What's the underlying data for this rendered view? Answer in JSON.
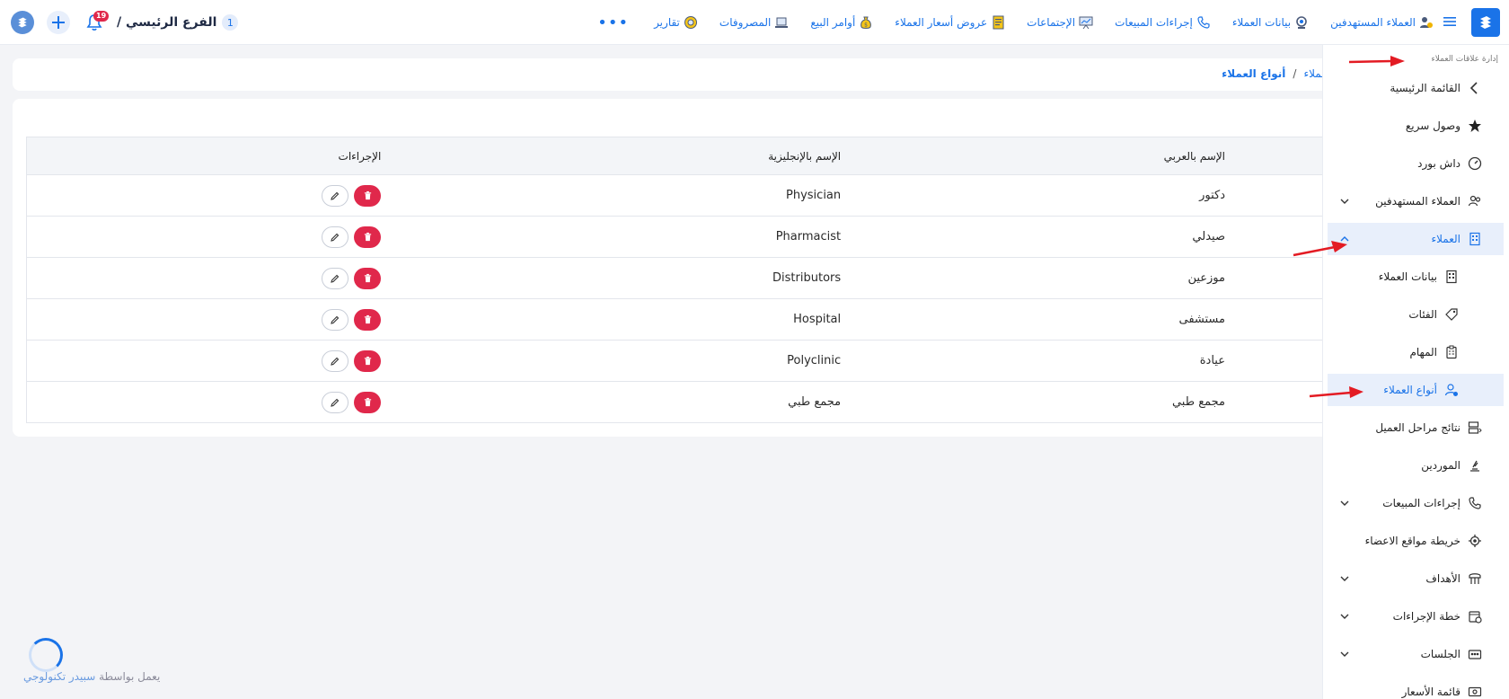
{
  "topbar": {
    "nav": [
      {
        "label": "العملاء المستهدفين",
        "icon": "targeted-clients-icon"
      },
      {
        "label": "بيانات العملاء",
        "icon": "webcam-icon"
      },
      {
        "label": "إجراءات المبيعات",
        "icon": "phone-icon"
      },
      {
        "label": "الإجتماعات",
        "icon": "presentation-icon"
      },
      {
        "label": "عروض أسعار العملاء",
        "icon": "quote-icon"
      },
      {
        "label": "أوامر البيع",
        "icon": "money-bag-icon"
      },
      {
        "label": "المصروفات",
        "icon": "laptop-icon"
      },
      {
        "label": "تقارير",
        "icon": "report-icon"
      }
    ],
    "more": "•••",
    "branch_label": "الفرع الرئيسي /",
    "branch_number": "1",
    "notifications_count": "19"
  },
  "breadcrumb": {
    "parent": "العملاء",
    "separator": "/",
    "current": "أنواع العملاء"
  },
  "table": {
    "headers": {
      "arabic_name": "الإسم بالعربي",
      "english_name": "الإسم بالإنجليزية",
      "actions": "الإجراءات"
    },
    "rows": [
      {
        "ar": "دكتور",
        "en": "Physician"
      },
      {
        "ar": "صيدلي",
        "en": "Pharmacist"
      },
      {
        "ar": "موزعين",
        "en": "Distributors"
      },
      {
        "ar": "مستشفى",
        "en": "Hospital"
      },
      {
        "ar": "عيادة",
        "en": "Polyclinic"
      },
      {
        "ar": "مجمع طبي",
        "en": "مجمع طبي"
      }
    ]
  },
  "sidebar": {
    "title": "إدارة علاقات العملاء",
    "items": [
      {
        "label": "القائمة الرئيسية",
        "icon": "chevron-left-icon"
      },
      {
        "label": "وصول سريع",
        "icon": "star-icon"
      },
      {
        "label": "داش بورد",
        "icon": "speedometer-icon"
      },
      {
        "label": "العملاء المستهدفين",
        "icon": "users-icon"
      },
      {
        "label": "العملاء",
        "icon": "building-icon"
      },
      {
        "label": "بيانات العملاء",
        "icon": "building-icon"
      },
      {
        "label": "الفئات",
        "icon": "tag-icon"
      },
      {
        "label": "المهام",
        "icon": "clipboard-icon"
      },
      {
        "label": "أنواع العملاء",
        "icon": "user-badge-icon"
      },
      {
        "label": "نتائج مراحل العميل",
        "icon": "stages-icon"
      },
      {
        "label": "الموردين",
        "icon": "supplier-icon"
      },
      {
        "label": "إجراءات المبيعات",
        "icon": "phone-call-icon"
      },
      {
        "label": "خريطة مواقع الاعضاء",
        "icon": "location-icon"
      },
      {
        "label": "الأهداف",
        "icon": "target-icon"
      },
      {
        "label": "خطة الإجراءات",
        "icon": "calendar-plan-icon"
      },
      {
        "label": "الجلسات",
        "icon": "sessions-icon"
      },
      {
        "label": "قائمة الأسعار",
        "icon": "price-list-icon"
      }
    ]
  },
  "footer": {
    "powered_by": "يعمل بواسطة",
    "company": "سبيدر تكنولوجي"
  },
  "colors": {
    "accent": "#1a73e8",
    "danger": "#e0284b",
    "background": "#f3f4f7",
    "annotation_arrow": "#e31b23"
  }
}
